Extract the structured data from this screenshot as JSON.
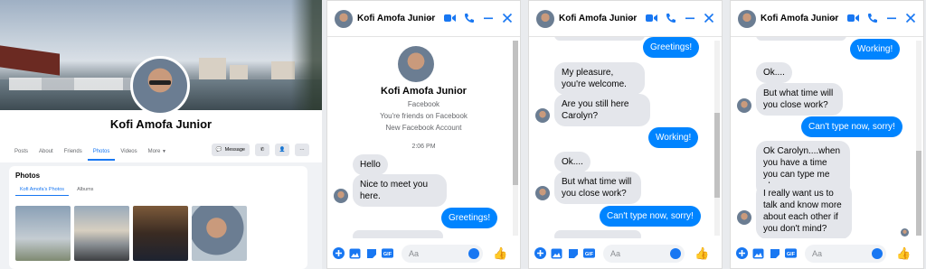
{
  "profile": {
    "name": "Kofi Amofa Junior",
    "tabs": [
      "Posts",
      "About",
      "Friends",
      "Photos",
      "Videos",
      "More"
    ],
    "active_tab": "Photos",
    "message_button": "Message",
    "photos_title": "Photos",
    "photos_tabs": [
      "Kofi Amofa's Photos",
      "Albums"
    ]
  },
  "chat1": {
    "contact": "Kofi Amofa Junior",
    "intro": {
      "name": "Kofi Amofa Junior",
      "source": "Facebook",
      "friends": "You're friends on Facebook",
      "account": "New Facebook Account"
    },
    "time": "2:06 PM",
    "messages": [
      {
        "dir": "in",
        "text": "Hello"
      },
      {
        "dir": "in",
        "text": "Nice to meet you here."
      },
      {
        "dir": "out",
        "text": "Greetings!"
      }
    ],
    "input_placeholder": "Aa"
  },
  "chat2": {
    "contact": "Kofi Amofa Junior",
    "messages": [
      {
        "dir": "out",
        "text": "Greetings!"
      },
      {
        "dir": "in",
        "text": "My pleasure, you're welcome."
      },
      {
        "dir": "in",
        "text": "Are you still here Carolyn?"
      },
      {
        "dir": "out",
        "text": "Working!"
      },
      {
        "dir": "in",
        "text": "Ok...."
      },
      {
        "dir": "in",
        "text": "But what time will you close work?"
      },
      {
        "dir": "out",
        "text": "Can't type now, sorry!"
      }
    ],
    "input_placeholder": "Aa"
  },
  "chat3": {
    "contact": "Kofi Amofa Junior",
    "messages": [
      {
        "dir": "out",
        "text": "Working!"
      },
      {
        "dir": "in",
        "text": "Ok...."
      },
      {
        "dir": "in",
        "text": "But what time will you close work?"
      },
      {
        "dir": "out",
        "text": "Can't type now, sorry!"
      },
      {
        "dir": "in",
        "text": "Ok Carolyn....when you have a time you can type me ok."
      },
      {
        "dir": "in",
        "text": "I really want us to talk and know more about each other if you don't mind?"
      }
    ],
    "input_placeholder": "Aa"
  },
  "colors": {
    "accent": "#1877f2",
    "outgoing_bubble": "#0084ff",
    "incoming_bubble": "#e4e6eb"
  }
}
